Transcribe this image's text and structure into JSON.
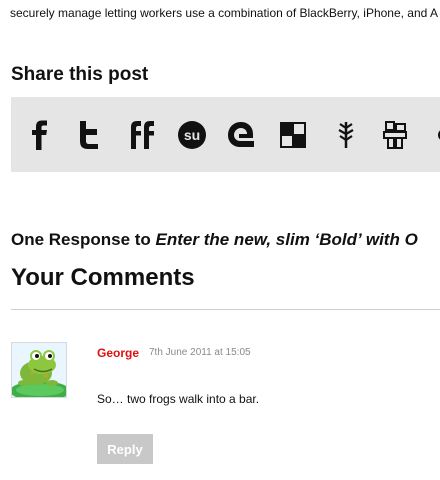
{
  "post": {
    "intro_text": "securely manage letting workers use a combination of BlackBerry, iPhone, and A"
  },
  "share": {
    "heading": "Share this post",
    "icons": [
      "facebook-icon",
      "twitter-icon",
      "friendfeed-icon",
      "stumbleupon-icon",
      "google-buzz-icon",
      "delicious-icon",
      "diigo-icon",
      "netvibes-icon",
      "more-icon"
    ],
    "bar_color": "#e5e5e5"
  },
  "responses": {
    "prefix": "One Response to ",
    "post_title": "Enter the new, slim ‘Bold’ with O"
  },
  "comments": {
    "heading": "Your Comments",
    "items": [
      {
        "author": "George",
        "date": "7th June 2011 at 15:05",
        "text": "So… two frogs walk into a bar.",
        "avatar": "frog-avatar",
        "reply_label": "Reply"
      }
    ]
  },
  "colors": {
    "author": "#dd1111",
    "reply_button": "#c8c8c8",
    "date": "#8a8a8a"
  }
}
